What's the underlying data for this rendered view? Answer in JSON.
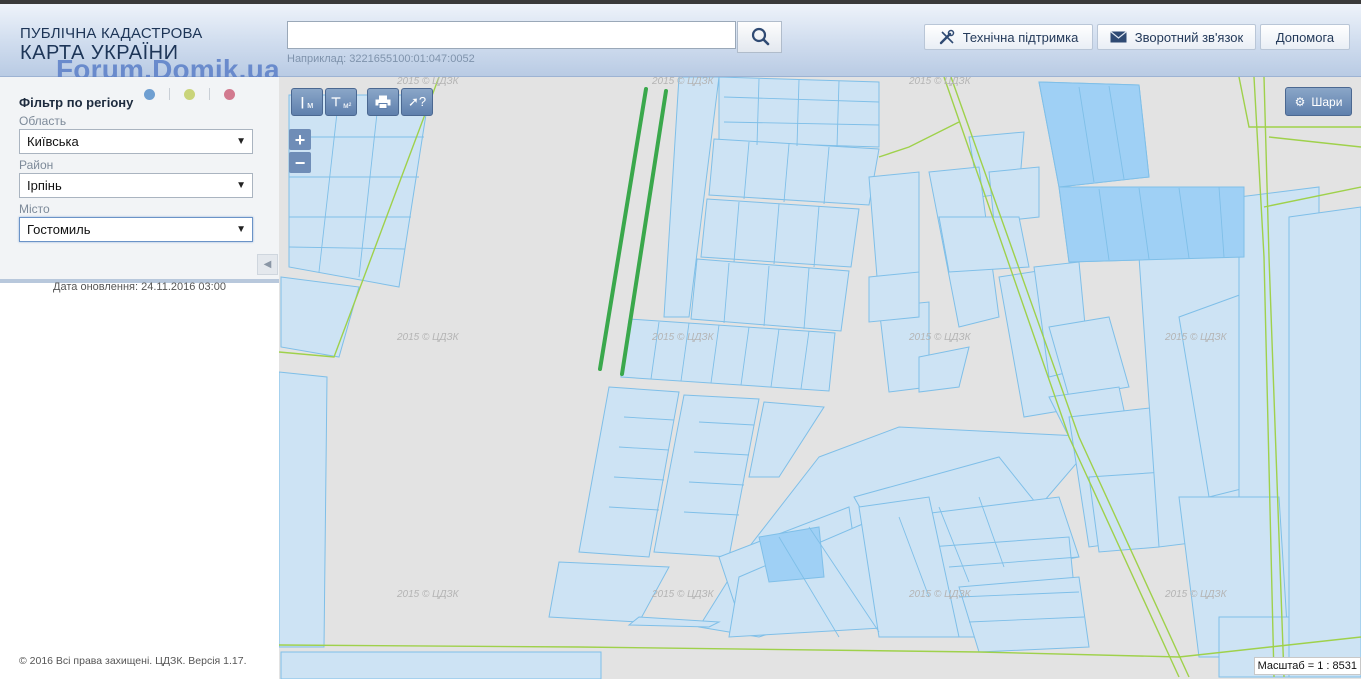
{
  "header": {
    "title_line1": "ПУБЛІЧНА КАДАСТРОВА",
    "title_line2": "КАРТА УКРАЇНИ",
    "watermark": "Forum.Domik.ua",
    "search": {
      "value": "",
      "example": "Наприклад: 3221655100:01:047:0052"
    },
    "buttons": {
      "support": "Технічна підтримка",
      "feedback": "Зворотний зв'язок",
      "help": "Допомога"
    }
  },
  "filter": {
    "title": "Фільтр по регіону",
    "region_label": "Область",
    "region_value": "Київська",
    "district_label": "Район",
    "district_value": "Ірпінь",
    "city_label": "Місто",
    "city_value": "Гостомиль",
    "dot_colors": [
      "#6f9fd1",
      "#c9d47a",
      "#d27a8f"
    ]
  },
  "updated": "Дата оновлення: 24.11.2016 03:00",
  "copyright": "© 2016 Всі права захищені. ЦДЗК. Версія 1.17.",
  "map": {
    "layers_button": "Шари",
    "tools": {
      "ruler_label": "м",
      "area_label": "м²"
    },
    "zoom_in": "+",
    "zoom_out": "−",
    "scale": "Масштаб = 1 : 8531",
    "tile_watermark": "2015 © ЦДЗК",
    "colors": {
      "background": "#e3e3e3",
      "parcel_fill": "#cde3f4",
      "parcel_stroke": "#7fbfe8",
      "highlight_fill": "#9fd0f5",
      "boundary": "#9fd14b",
      "marked_line": "#3aa84c"
    }
  }
}
